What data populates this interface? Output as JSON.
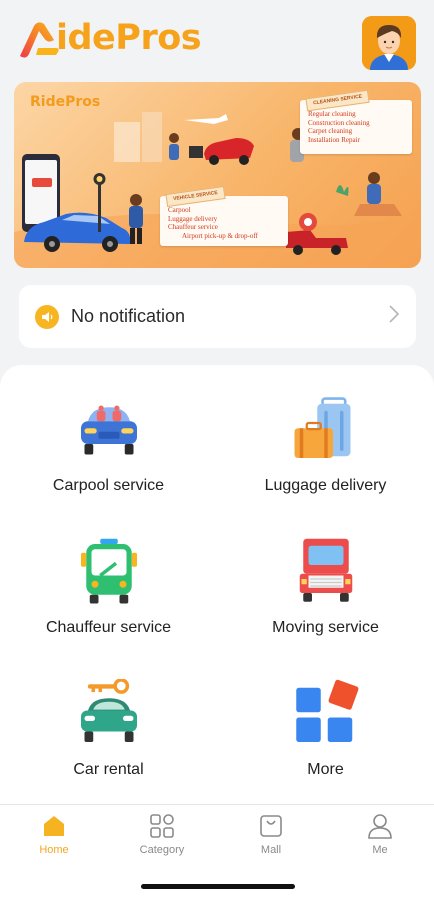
{
  "app": {
    "logo_text": "idePros"
  },
  "banner": {
    "logo_text": "RidePros",
    "cleaning_tag": "CLEANING SERVICE",
    "cleaning_items": [
      "Regular cleaning",
      "Construction cleaning",
      "Carpet cleaning",
      "Installation Repair"
    ],
    "vehicle_tag": "VEHICLE SERVICE",
    "vehicle_items": [
      "Carpool",
      "Luggage delivery",
      "Chauffeur service",
      "Airport pick-up & drop-off"
    ],
    "phone_label": "RidePros"
  },
  "notification": {
    "text": "No notification"
  },
  "services": [
    {
      "label": "Carpool service",
      "icon": "car-icon"
    },
    {
      "label": "Luggage delivery",
      "icon": "luggage-icon"
    },
    {
      "label": "Chauffeur service",
      "icon": "bus-icon"
    },
    {
      "label": "Moving service",
      "icon": "truck-icon"
    },
    {
      "label": "Car rental",
      "icon": "car-key-icon"
    },
    {
      "label": "More",
      "icon": "grid-more-icon"
    }
  ],
  "tabs": [
    {
      "label": "Home",
      "icon": "home-icon",
      "active": true
    },
    {
      "label": "Category",
      "icon": "category-icon",
      "active": false
    },
    {
      "label": "Mall",
      "icon": "bag-icon",
      "active": false
    },
    {
      "label": "Me",
      "icon": "person-icon",
      "active": false
    }
  ],
  "colors": {
    "accent": "#f5a623",
    "brand_orange": "#f7a21b",
    "background": "#f2f3f5"
  }
}
